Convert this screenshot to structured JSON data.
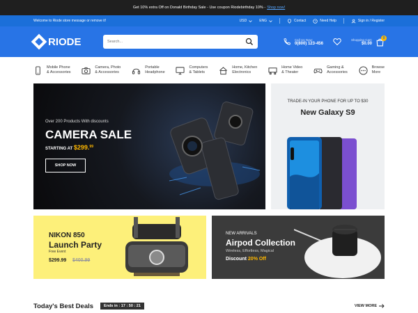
{
  "promo": {
    "text": "Get 10% extra Off on Donald Birthday Sale - Use coupon Riodebirthday 10% -",
    "link": "Shop now!"
  },
  "topbar": {
    "welcome": "Welcome to Riode store message or remove it!",
    "currency": "USD",
    "language": "ENG",
    "contact": "Contact",
    "help": "Need Help",
    "signin": "Sign in / Register"
  },
  "header": {
    "logo": "RIODE",
    "search_placeholder": "Search...",
    "call_label": "Call Us Now:",
    "phone": "0(800) 123-456",
    "cart_label": "Shopping Cart:",
    "cart_total": "$0.00",
    "cart_count": "0"
  },
  "categories": [
    {
      "l1": "Mobile Phone",
      "l2": "& Accessories",
      "icon": "phone-icon"
    },
    {
      "l1": "Camera, Photo",
      "l2": "& Accessories",
      "icon": "camera-icon"
    },
    {
      "l1": "Portable",
      "l2": "Headphone",
      "icon": "headphone-icon"
    },
    {
      "l1": "Computers",
      "l2": "& Tablets",
      "icon": "monitor-icon"
    },
    {
      "l1": "Home, Kitchen",
      "l2": "Electronics",
      "icon": "kitchen-icon"
    },
    {
      "l1": "Home Video",
      "l2": "& Theater",
      "icon": "theater-icon"
    },
    {
      "l1": "Gaming &",
      "l2": "Accessories",
      "icon": "gamepad-icon"
    },
    {
      "l1": "Browse",
      "l2": "More",
      "icon": "more-icon"
    }
  ],
  "hero": {
    "subtitle": "Over 200 Products With discounts",
    "title": "CAMERA SALE",
    "price_prefix": "STARTING AT",
    "price": "$299.",
    "price_cents": "99",
    "button": "SHOP NOW"
  },
  "side_banner": {
    "line1": "TRADE-IN  YOUR PHONE FOR UP TO $30",
    "line2": "New Galaxy S9"
  },
  "banner_nikon": {
    "line1": "NIKON 850",
    "line2": "Launch Party",
    "line3": "Free Event",
    "price": "$299.99",
    "old_price": "$400.99"
  },
  "banner_airpod": {
    "line1": "NEW ARRIVALS",
    "line2": "Airpod Collection",
    "line3": "Wireless, Effortless, Magical",
    "discount_prefix": "Discount",
    "discount": "20% Off"
  },
  "deals": {
    "title": "Today's Best Deals",
    "timer": "Ends in : 17 : 50 : 21",
    "more": "VIEW MORE"
  },
  "colors": {
    "brand": "#2874e6",
    "accent": "#ffb800",
    "dark": "#1f1f1f"
  }
}
